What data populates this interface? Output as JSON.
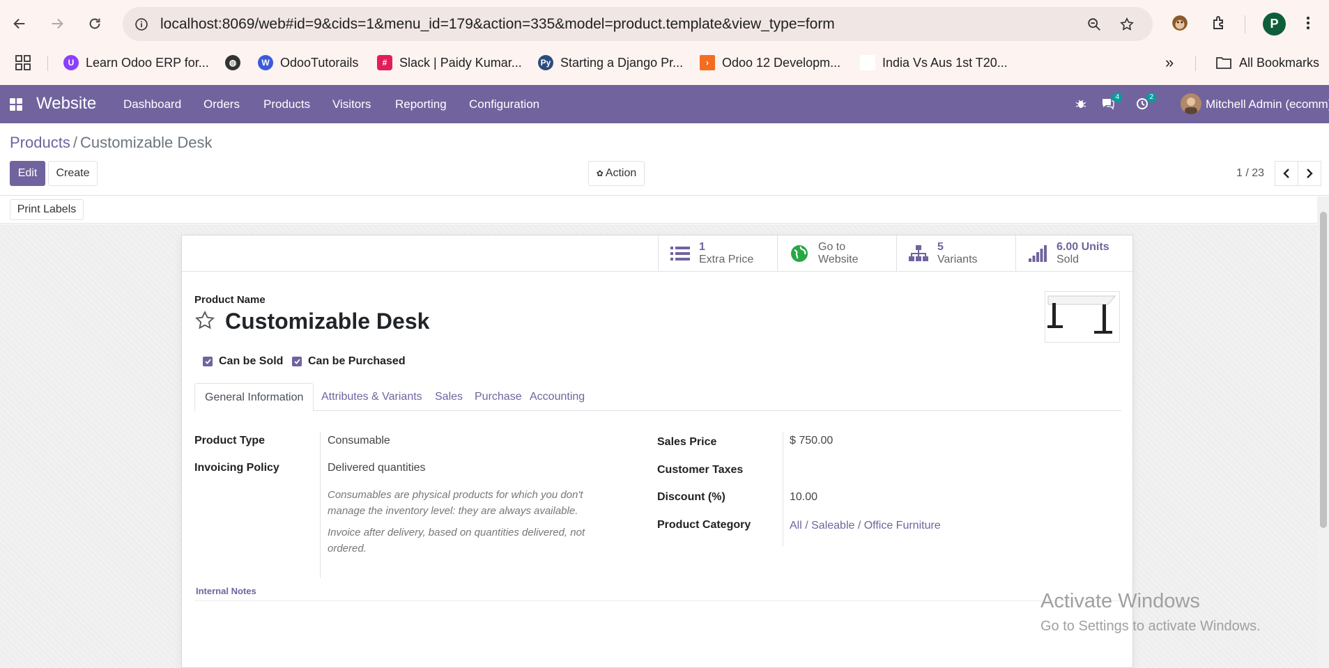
{
  "browser": {
    "url": "localhost:8069/web#id=9&cids=1&menu_id=179&action=335&model=product.template&view_type=form",
    "profile_initial": "P",
    "bookmarks": [
      {
        "label": "Learn Odoo ERP for...",
        "color": "#8a3ffc"
      },
      {
        "label": "",
        "color": "#333333"
      },
      {
        "label": "OdooTutorails",
        "color": "#3b5bdb"
      },
      {
        "label": "Slack | Paidy Kumar...",
        "color": "#e01e5a"
      },
      {
        "label": "Starting a Django Pr...",
        "color": "#2b4c7e"
      },
      {
        "label": "Odoo 12 Developm...",
        "color": "#f36d21"
      },
      {
        "label": "India Vs Aus 1st T20...",
        "color": "#ffffff"
      }
    ],
    "all_bookmarks": "All Bookmarks"
  },
  "navbar": {
    "brand": "Website",
    "menu": [
      "Dashboard",
      "Orders",
      "Products",
      "Visitors",
      "Reporting",
      "Configuration"
    ],
    "messages_count": "4",
    "activities_count": "2",
    "user": "Mitchell Admin (ecomm)",
    "color": "#71639e"
  },
  "breadcrumb": {
    "parent": "Products",
    "separator": "/",
    "current": "Customizable Desk"
  },
  "toolbar": {
    "edit": "Edit",
    "create": "Create",
    "action": "Action",
    "pager": "1 / 23",
    "print_labels": "Print Labels"
  },
  "stats": [
    {
      "num": "1",
      "label": "Extra Price",
      "icon": "list-icon"
    },
    {
      "num": "Go to",
      "label": "Website",
      "icon": "globe-icon"
    },
    {
      "num": "5",
      "label": "Variants",
      "icon": "sitemap-icon"
    },
    {
      "num": "6.00 Units",
      "label": "Sold",
      "icon": "signal-icon"
    }
  ],
  "product": {
    "name_label": "Product Name",
    "name": "Customizable Desk",
    "can_be_sold": "Can be Sold",
    "can_be_purchased": "Can be Purchased"
  },
  "tabs": [
    "General Information",
    "Attributes & Variants",
    "Sales",
    "Purchase",
    "Accounting"
  ],
  "general": {
    "product_type_label": "Product Type",
    "product_type": "Consumable",
    "invoicing_policy_label": "Invoicing Policy",
    "invoicing_policy": "Delivered quantities",
    "help_consumable": "Consumables are physical products for which you don't manage the inventory level: they are always available.",
    "help_invoice": "Invoice after delivery, based on quantities delivered, not ordered.",
    "sales_price_label": "Sales Price",
    "sales_price": "$ 750.00",
    "customer_taxes_label": "Customer Taxes",
    "customer_taxes": "",
    "discount_label": "Discount (%)",
    "discount": "10.00",
    "category_label": "Product Category",
    "category": "All / Saleable / Office Furniture",
    "internal_notes": "Internal Notes"
  },
  "watermark": {
    "line1": "Activate Windows",
    "line2": "Go to Settings to activate Windows."
  }
}
